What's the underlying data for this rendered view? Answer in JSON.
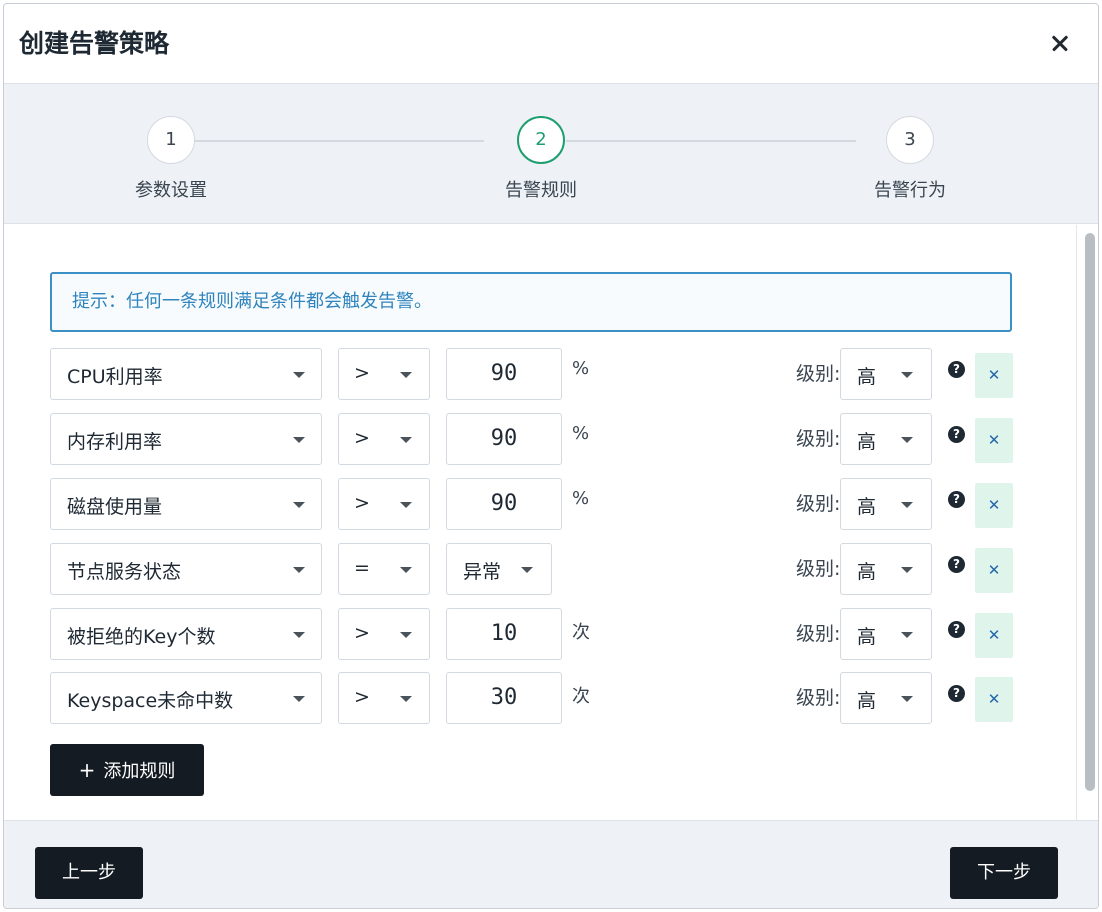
{
  "dialog": {
    "title": "创建告警策略"
  },
  "steps": [
    {
      "number": "1",
      "label": "参数设置",
      "active": false
    },
    {
      "number": "2",
      "label": "告警规则",
      "active": true
    },
    {
      "number": "3",
      "label": "告警行为",
      "active": false
    }
  ],
  "hint": "提示：任何一条规则满足条件都会触发告警。",
  "level_label": "级别:",
  "rules": [
    {
      "metric": "CPU利用率",
      "operator": ">",
      "value": "90",
      "unit": "%",
      "level": "高"
    },
    {
      "metric": "内存利用率",
      "operator": ">",
      "value": "90",
      "unit": "%",
      "level": "高"
    },
    {
      "metric": "磁盘使用量",
      "operator": ">",
      "value": "90",
      "unit": "%",
      "level": "高"
    },
    {
      "metric": "节点服务状态",
      "operator": "=",
      "value": "异常",
      "unit": "",
      "level": "高"
    },
    {
      "metric": "被拒绝的Key个数",
      "operator": ">",
      "value": "10",
      "unit": "次",
      "level": "高"
    },
    {
      "metric": "Keyspace未命中数",
      "operator": ">",
      "value": "30",
      "unit": "次",
      "level": "高"
    }
  ],
  "add_rule_label": "添加规则",
  "footer": {
    "prev_label": "上一步",
    "next_label": "下一步"
  },
  "icons": {
    "close": "close-icon",
    "help": "question-circle-icon",
    "delete": "x-icon",
    "add": "plus-icon",
    "caret": "caret-down-icon"
  },
  "colors": {
    "accent_green": "#1e9e6e",
    "hint_blue": "#2f84bd",
    "delete_bg": "#dff5ec",
    "primary_dark": "#141b22"
  }
}
